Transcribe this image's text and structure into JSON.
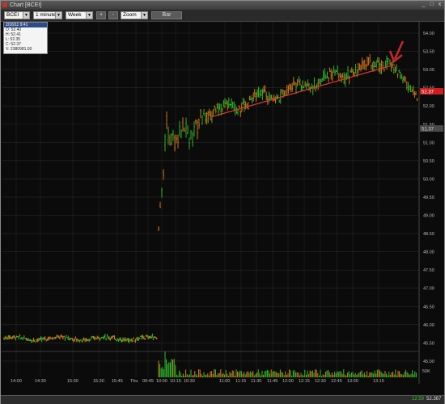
{
  "window": {
    "title": "Chart [BCEI]",
    "minimize": "_",
    "maximize": "□",
    "close": "x"
  },
  "toolbar": {
    "symbol": "BCEI",
    "interval": "1 minute",
    "range": "Week",
    "zoom_in": "+",
    "zoom_out": "-",
    "zoom": "Zoom",
    "chart_type": "Bar"
  },
  "infobox": {
    "date": "2/16/11 9:41",
    "open": "O: 52.40",
    "high": "H: 52.41",
    "low": "L: 52.35",
    "close": "C: 52.37",
    "volume": "V: 2380981.00"
  },
  "price_axis": [
    "54.00",
    "53.50",
    "53.00",
    "52.50",
    "52.00",
    "51.50",
    "51.00",
    "50.50",
    "50.00",
    "49.50",
    "49.00",
    "48.50",
    "48.00",
    "47.50",
    "47.00",
    "46.50",
    "46.00",
    "45.50",
    "45.00"
  ],
  "last_price_tag": "52.37",
  "prev_tag": "51.37",
  "volume_axis": "50K",
  "time_axis": [
    "14:00",
    "14:30",
    "15:00",
    "15:30",
    "15:45",
    "Thu",
    "09:45",
    "10:00",
    "10:15",
    "10:30",
    "11:00",
    "11:15",
    "11:30",
    "11:45",
    "12:00",
    "12:15",
    "12:30",
    "12:45",
    "13:00",
    "13:15"
  ],
  "status": {
    "left": "12:59",
    "right": "52.367"
  },
  "colors": {
    "up": "#2ec22e",
    "down": "#e07d17",
    "trendline": "#d93a32",
    "arrow": "#c8282a",
    "grid": "#2a2a2a"
  }
}
